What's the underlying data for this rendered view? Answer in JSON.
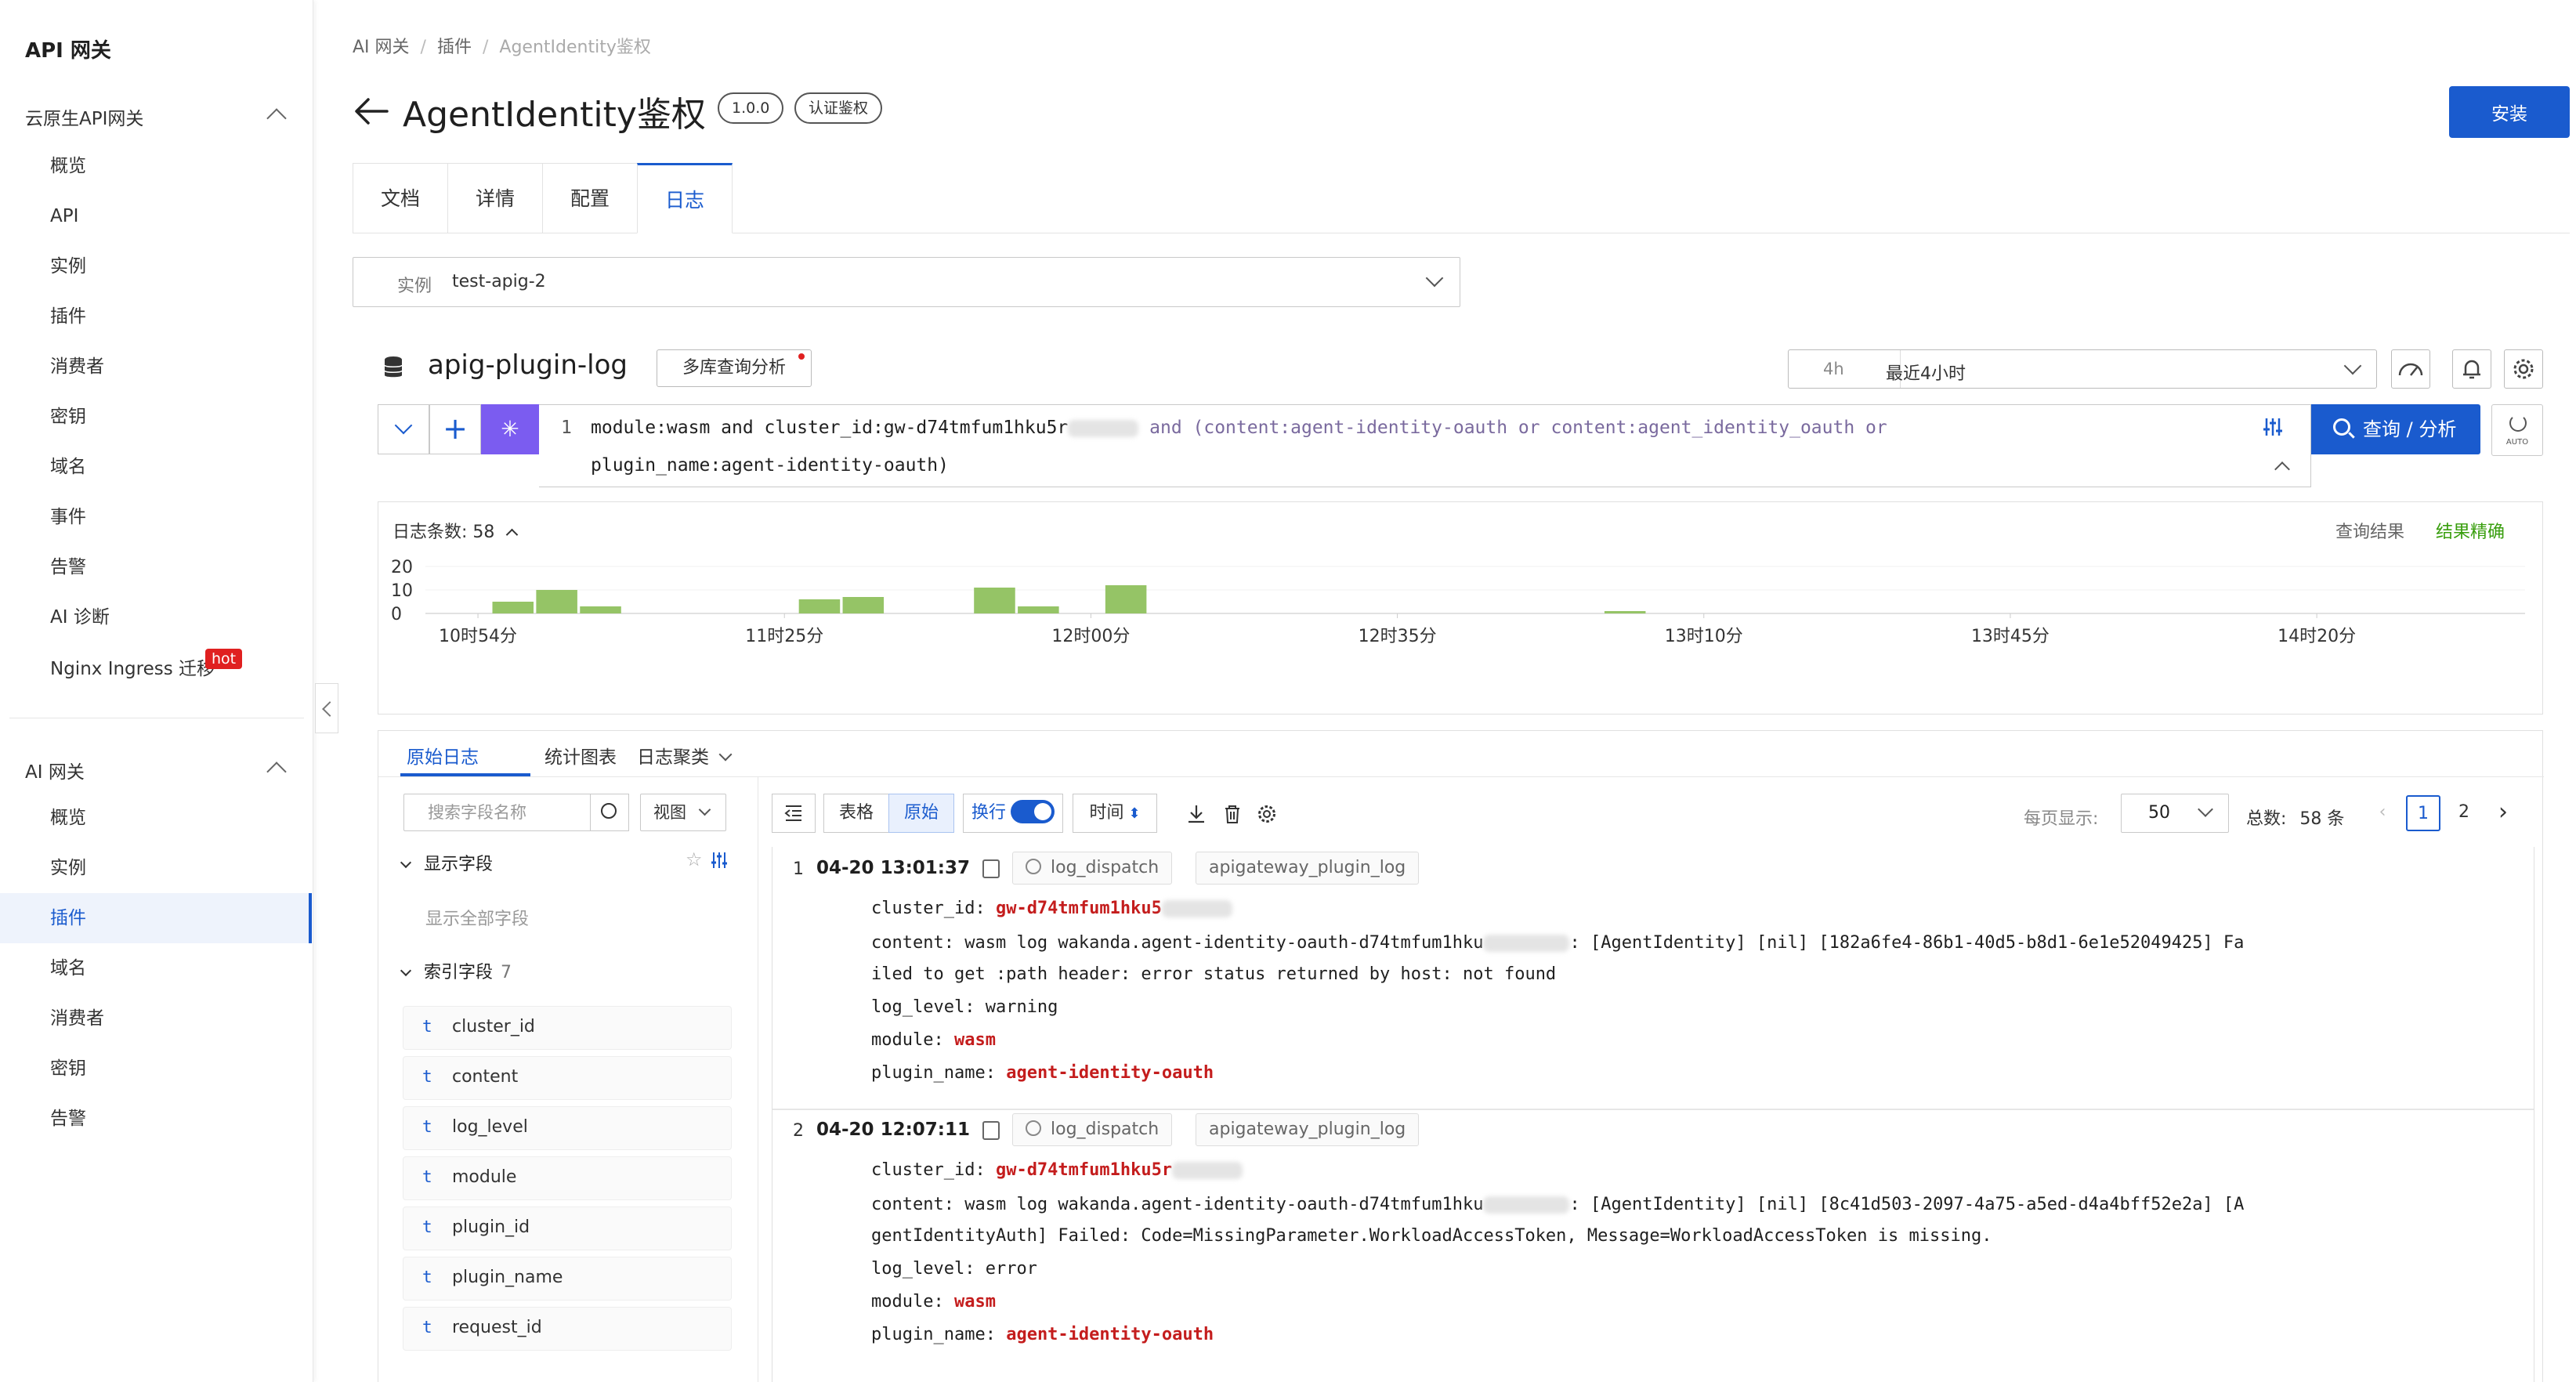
{
  "sidebar": {
    "title": "API 网关",
    "group1": "云原生API网关",
    "group1_items": [
      "概览",
      "API",
      "实例",
      "插件",
      "消费者",
      "密钥",
      "域名",
      "事件",
      "告警",
      "AI 诊断",
      "Nginx Ingress 迁移"
    ],
    "hot_badge": "hot",
    "group2": "AI 网关",
    "group2_items": [
      "概览",
      "实例",
      "插件",
      "域名",
      "消费者",
      "密钥",
      "告警"
    ],
    "active_item": "插件"
  },
  "breadcrumb": [
    "AI 网关",
    "插件",
    "AgentIdentity鉴权"
  ],
  "header": {
    "title": "AgentIdentity鉴权",
    "version_tag": "1.0.0",
    "category_tag": "认证鉴权",
    "install_label": "安装"
  },
  "tabs": [
    "文档",
    "详情",
    "配置",
    "日志"
  ],
  "active_tab": "日志",
  "instance": {
    "label": "实例",
    "value": "test-apig-2"
  },
  "logstore": {
    "name": "apig-plugin-log",
    "multi_query_label": "多库查询分析",
    "time_quick": "4h",
    "time_range": "最近4小时"
  },
  "query": {
    "line_no": "1",
    "line1_a": "module:wasm and cluster_id:gw-d74tmfum1hku5r",
    "line1_b": " and (content:agent-identity-oauth or content:agent_identity_oauth or",
    "line2": "plugin_name:agent-identity-oauth)",
    "search_label": "查询 / 分析",
    "auto_label": "AUTO"
  },
  "histogram": {
    "count_label": "日志条数:",
    "count_value": "58",
    "right_label": "查询结果",
    "right_status": "结果精确"
  },
  "chart_data": {
    "type": "bar",
    "title": "",
    "xlabel": "",
    "ylabel": "",
    "ylim": [
      0,
      20
    ],
    "y_ticks": [
      "20",
      "10",
      "0"
    ],
    "x_ticks": [
      "10时54分",
      "11时25分",
      "12时00分",
      "12时35分",
      "13时10分",
      "13时45分",
      "14时20分"
    ],
    "bar_color": "#95c466",
    "bins": [
      {
        "x": "10:58",
        "value": 5
      },
      {
        "x": "11:03",
        "value": 10
      },
      {
        "x": "11:08",
        "value": 3
      },
      {
        "x": "11:33",
        "value": 6
      },
      {
        "x": "11:38",
        "value": 7
      },
      {
        "x": "11:53",
        "value": 11
      },
      {
        "x": "11:58",
        "value": 3
      },
      {
        "x": "12:08",
        "value": 12
      },
      {
        "x": "13:05",
        "value": 1
      }
    ]
  },
  "results": {
    "tabs": [
      "原始日志",
      "统计图表",
      "日志聚类"
    ],
    "field_search_placeholder": "搜索字段名称",
    "view_label": "视图",
    "display_fields_label": "显示字段",
    "show_all_label": "显示全部字段",
    "index_fields_label": "索引字段",
    "index_fields_count": "7",
    "field_type": "t",
    "fields": [
      "cluster_id",
      "content",
      "log_level",
      "module",
      "plugin_id",
      "plugin_name",
      "request_id"
    ],
    "toolbar": {
      "table": "表格",
      "raw": "原始",
      "wrap": "换行",
      "time": "时间",
      "per_page_label": "每页显示:",
      "per_page_value": "50",
      "total_label": "总数:",
      "total_value": "58 条",
      "pages": [
        "1",
        "2"
      ]
    },
    "entries": [
      {
        "index": "1",
        "time": "04-20 13:01:37",
        "chips": [
          "log_dispatch",
          "apigateway_plugin_log"
        ],
        "cluster_key": "cluster_id:",
        "cluster_val": "gw-d74tmfum1hku5",
        "content_key": "content:",
        "content_l1_a": "wasm log wakanda.agent-identity-oauth-d74tmfum1hku",
        "content_l1_b": ": [AgentIdentity] [nil] [182a6fe4-86b1-40d5-b8d1-6e1e52049425] Fa",
        "content_l2": "iled to get :path header: error status returned by host: not found",
        "level_key": "log_level:",
        "level_val": "warning",
        "module_key": "module:",
        "module_val": "wasm",
        "plugin_key": "plugin_name:",
        "plugin_val": "agent-identity-oauth"
      },
      {
        "index": "2",
        "time": "04-20 12:07:11",
        "chips": [
          "log_dispatch",
          "apigateway_plugin_log"
        ],
        "cluster_key": "cluster_id:",
        "cluster_val": "gw-d74tmfum1hku5r",
        "content_key": "content:",
        "content_l1_a": "wasm log wakanda.agent-identity-oauth-d74tmfum1hku",
        "content_l1_b": ": [AgentIdentity] [nil] [8c41d503-2097-4a75-a5ed-d4a4bff52e2a] [A",
        "content_l2": "gentIdentityAuth] Failed: Code=MissingParameter.WorkloadAccessToken, Message=WorkloadAccessToken is missing.",
        "level_key": "log_level:",
        "level_val": "error",
        "module_key": "module:",
        "module_val": "wasm",
        "plugin_key": "plugin_name:",
        "plugin_val": "agent-identity-oauth"
      }
    ]
  },
  "colors": {
    "primary": "#1a5bce",
    "ai": "#7b5cf0",
    "value_red": "#c41d1d",
    "exact_green": "#389e0d"
  }
}
